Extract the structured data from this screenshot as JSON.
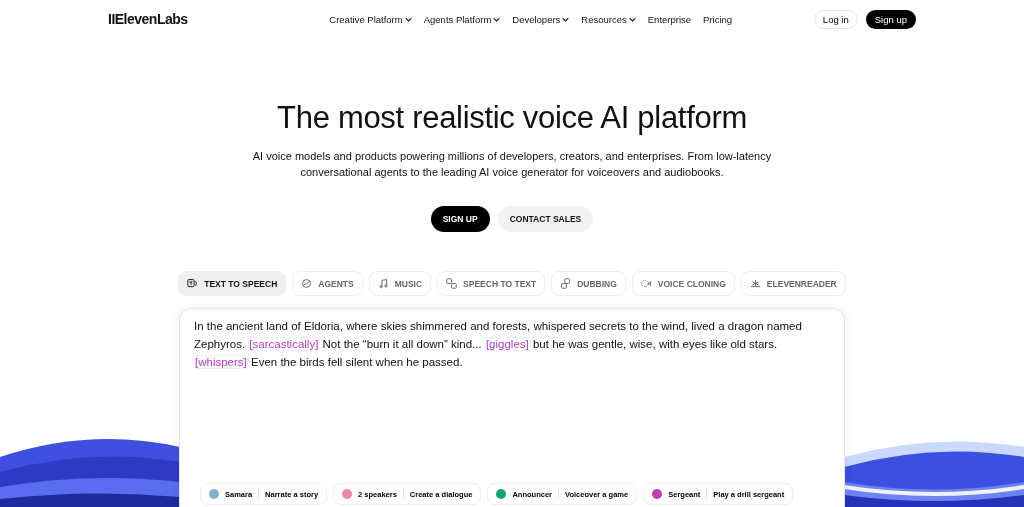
{
  "brand": "IIElevenLabs",
  "nav": [
    {
      "label": "Creative Platform",
      "dropdown": true
    },
    {
      "label": "Agents Platform",
      "dropdown": true
    },
    {
      "label": "Developers",
      "dropdown": true
    },
    {
      "label": "Resources",
      "dropdown": true
    },
    {
      "label": "Enterprise",
      "dropdown": false
    },
    {
      "label": "Pricing",
      "dropdown": false
    }
  ],
  "login": "Log in",
  "signup": "Sign up",
  "hero": {
    "title": "The most realistic voice AI platform",
    "subtitle": "AI voice models and products powering millions of developers, creators, and enterprises. From low-latency conversational agents to the leading AI voice generator for voiceovers and audiobooks.",
    "primary": "SIGN UP",
    "secondary": "CONTACT SALES"
  },
  "tabs": [
    {
      "label": "TEXT TO SPEECH",
      "kind": "tts",
      "selected": true
    },
    {
      "label": "AGENTS",
      "kind": "agents",
      "selected": false
    },
    {
      "label": "MUSIC",
      "kind": "music",
      "selected": false
    },
    {
      "label": "SPEECH TO TEXT",
      "kind": "stt",
      "selected": false
    },
    {
      "label": "DUBBING",
      "kind": "dubbing",
      "selected": false
    },
    {
      "label": "VOICE CLONING",
      "kind": "cloning",
      "selected": false
    },
    {
      "label": "ELEVENREADER",
      "kind": "reader",
      "selected": false
    }
  ],
  "editor": {
    "segments": [
      {
        "kind": "text",
        "text": "In the ancient land of Eldoria, where skies shimmered and forests, whispered secrets to the wind, lived a dragon named Zephyros. "
      },
      {
        "kind": "tag",
        "text": "[sarcastically]"
      },
      {
        "kind": "text",
        "text": " Not the “burn it all down” kind... "
      },
      {
        "kind": "tag",
        "text": "[giggles]"
      },
      {
        "kind": "text",
        "text": " but he was gentle, wise, with eyes like old stars. "
      },
      {
        "kind": "tag",
        "text": "[whispers]"
      },
      {
        "kind": "text",
        "text": " Even the birds fell silent when he passed."
      }
    ]
  },
  "voices": [
    {
      "name": "Samara",
      "action": "Narrate a story",
      "color": "#7fb3c4"
    },
    {
      "name": "2 speakers",
      "action": "Create a dialogue",
      "color": "#e98aa0"
    },
    {
      "name": "Announcer",
      "action": "Voiceover a game",
      "color": "#1aa37a"
    },
    {
      "name": "Sergeant",
      "action": "Play a drill sergeant",
      "color": "#c23fb5"
    }
  ]
}
